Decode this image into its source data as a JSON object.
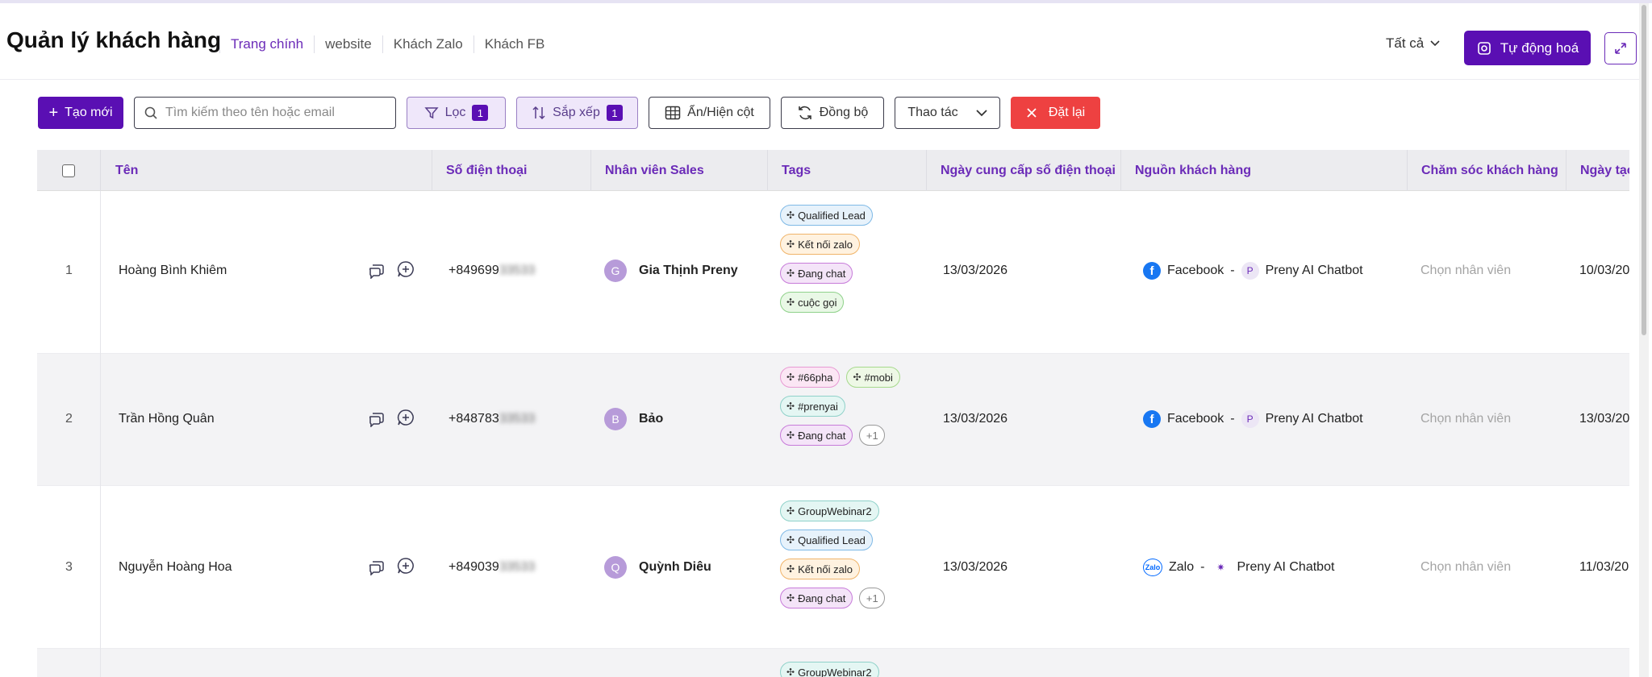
{
  "header": {
    "title": "Quản lý khách hàng",
    "tabs": [
      "Trang chính",
      "website",
      "Khách Zalo",
      "Khách FB"
    ],
    "filter_all": "Tất cả",
    "auto_button": "Tự động hoá"
  },
  "toolbar": {
    "create": "Tạo mới",
    "search_placeholder": "Tìm kiếm theo tên hoặc email",
    "filter": "Lọc",
    "filter_count": "1",
    "sort": "Sắp xếp",
    "sort_count": "1",
    "columns": "Ẩn/Hiện cột",
    "sync": "Đồng bộ",
    "actions": "Thao tác",
    "reset": "Đặt lại"
  },
  "table": {
    "headers": [
      "Tên",
      "Số điện thoại",
      "Nhân viên Sales",
      "Tags",
      "Ngày cung cấp số điện thoại",
      "Nguồn khách hàng",
      "Chăm sóc khách hàng",
      "Ngày tạo"
    ],
    "rows": [
      {
        "index": "1",
        "name": "Hoàng Bình Khiêm",
        "phone": "+849699",
        "phone_hidden": "33533",
        "sales_initial": "G",
        "sales": "Gia Thịnh Preny",
        "tags": [
          "Qualified Lead",
          "Kết nối zalo",
          "Đang chat",
          "cuộc gọi"
        ],
        "more": "",
        "phone_date": "13/03/2026",
        "source_channel": "Facebook",
        "source_sep": "-",
        "source_bot": "Preny AI Chatbot",
        "care": "Chọn nhân viên",
        "created": "10/03/20"
      },
      {
        "index": "2",
        "name": "Trần Hồng Quân",
        "phone": "+848783",
        "phone_hidden": "33533",
        "sales_initial": "B",
        "sales": "Bảo",
        "tags": [
          "#66pha",
          "#mobi",
          "#prenyai",
          "Đang chat"
        ],
        "more": "+1",
        "phone_date": "13/03/2026",
        "source_channel": "Facebook",
        "source_sep": "-",
        "source_bot": "Preny AI Chatbot",
        "care": "Chọn nhân viên",
        "created": "13/03/20"
      },
      {
        "index": "3",
        "name": "Nguyễn Hoàng Hoa",
        "phone": "+849039",
        "phone_hidden": "33533",
        "sales_initial": "Q",
        "sales": "Quỳnh Diêu",
        "tags": [
          "GroupWebinar2",
          "Qualified Lead",
          "Kết nối zalo",
          "Đang chat"
        ],
        "more": "+1",
        "phone_date": "13/03/2026",
        "source_channel": "Zalo",
        "source_sep": "-",
        "source_bot": "Preny AI Chatbot",
        "care": "Chọn nhân viên",
        "created": "11/03/20"
      },
      {
        "tags": [
          "GroupWebinar2"
        ]
      }
    ]
  },
  "icon_labels": {
    "zalo": "Zalo",
    "preny_p": "P",
    "facebook": "f"
  },
  "colors": {
    "brand": "#5a0fb3",
    "header_text": "#6b2bb8",
    "danger": "#ee4141"
  }
}
